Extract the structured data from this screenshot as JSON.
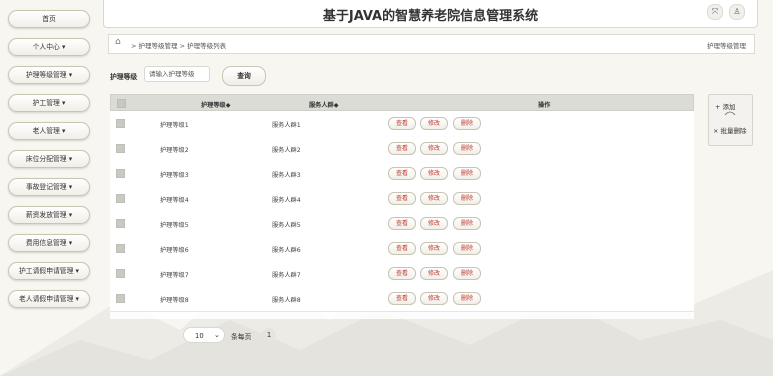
{
  "header": {
    "title": "基于JAVA的智慧养老院信息管理系统",
    "icons": [
      "fullscreen-icon",
      "user-icon"
    ]
  },
  "sidebar": {
    "items": [
      {
        "label": "首页"
      },
      {
        "label": "个人中心 ▾"
      },
      {
        "label": "护理等级管理 ▾"
      },
      {
        "label": "护工管理 ▾"
      },
      {
        "label": "老人管理 ▾"
      },
      {
        "label": "床位分配管理 ▾"
      },
      {
        "label": "事故登记管理 ▾"
      },
      {
        "label": "薪资发放管理 ▾"
      },
      {
        "label": "费用信息管理 ▾"
      },
      {
        "label": "护工请假申请管理 ▾"
      },
      {
        "label": "老人请假申请管理 ▾"
      }
    ]
  },
  "breadcrumb": {
    "path": "> 护理等级管理 > 护理等级列表",
    "right": "护理等级管理"
  },
  "search": {
    "label": "护理等级",
    "placeholder": "请输入护理等级",
    "button": "查询"
  },
  "table": {
    "columns": [
      "护理等级◆",
      "服务人群◆",
      "操作"
    ],
    "rows": [
      {
        "level": "护理等级1",
        "group": "服务人群1"
      },
      {
        "level": "护理等级2",
        "group": "服务人群2"
      },
      {
        "level": "护理等级3",
        "group": "服务人群3"
      },
      {
        "level": "护理等级4",
        "group": "服务人群4"
      },
      {
        "level": "护理等级5",
        "group": "服务人群5"
      },
      {
        "level": "护理等级6",
        "group": "服务人群6"
      },
      {
        "level": "护理等级7",
        "group": "服务人群7"
      },
      {
        "level": "护理等级8",
        "group": "服务人群8"
      }
    ],
    "row_actions": [
      "查看",
      "修改",
      "删除"
    ]
  },
  "actions": {
    "add": "+ 添加",
    "batch_delete": "× 批量删除"
  },
  "pagination": {
    "page_size": "10",
    "per_page_label": "条每页",
    "current_page": "1"
  }
}
